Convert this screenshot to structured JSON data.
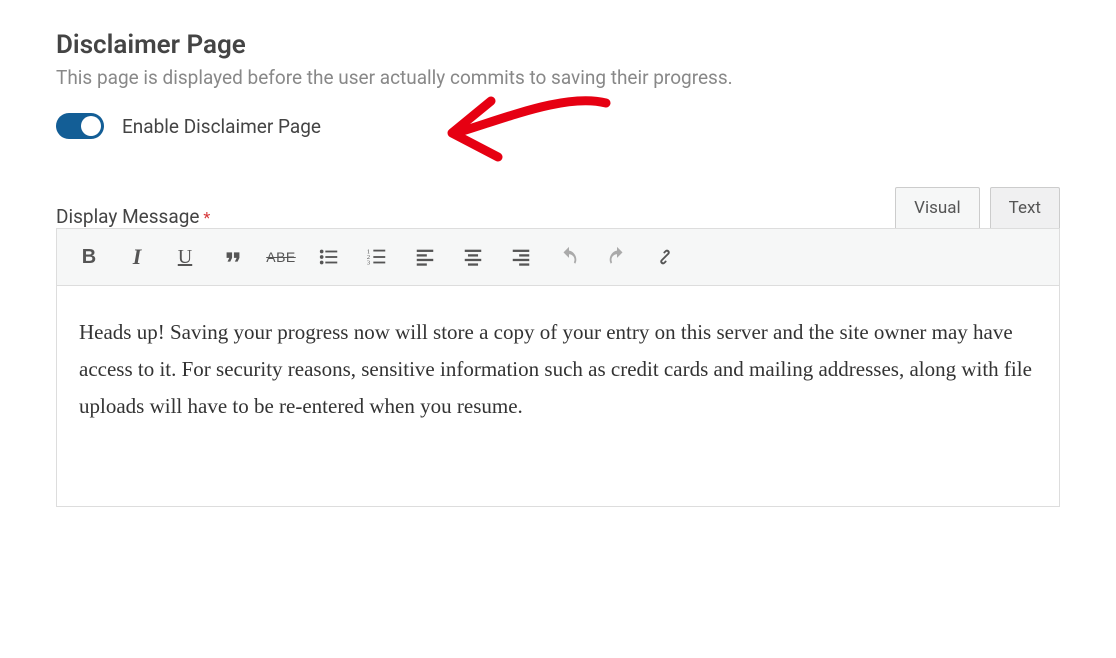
{
  "section": {
    "title": "Disclaimer Page",
    "description": "This page is displayed before the user actually commits to saving their progress."
  },
  "toggle": {
    "label": "Enable Disclaimer Page",
    "enabled": true
  },
  "field": {
    "label": "Display Message",
    "required_marker": "*"
  },
  "tabs": {
    "visual": "Visual",
    "text": "Text",
    "active": "visual"
  },
  "toolbar": {
    "bold": "B",
    "italic": "I",
    "underline": "U",
    "quote": "❝",
    "strike": "ABE"
  },
  "editor": {
    "content": "Heads up! Saving your progress now will store a copy of your entry on this server and the site owner may have access to it. For security reasons, sensitive information such as credit cards and mailing addresses, along with file uploads will have to be re-entered when you resume."
  },
  "annotation": {
    "color": "#e60012"
  }
}
